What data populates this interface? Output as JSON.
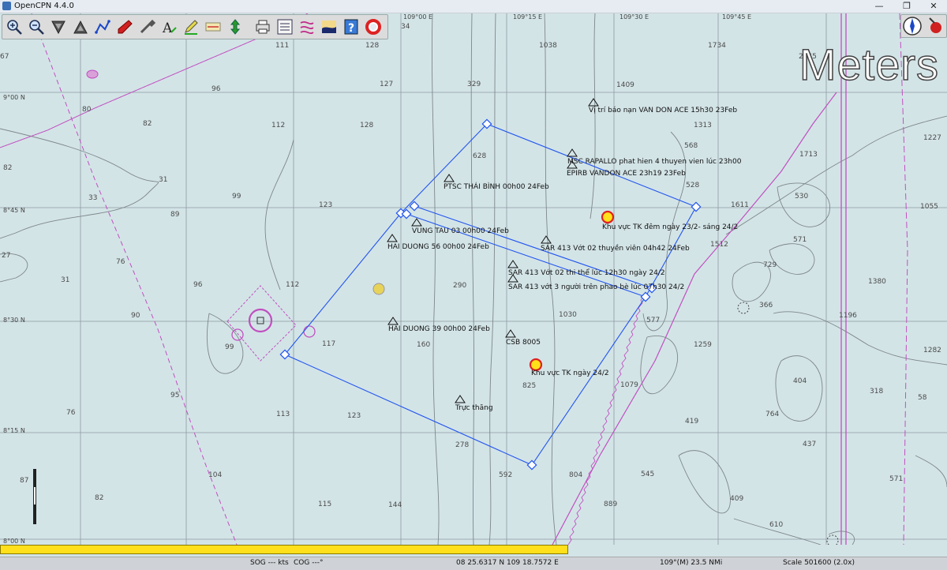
{
  "window": {
    "title": "OpenCPN 4.4.0",
    "minimize_symbol": "—",
    "restore_symbol": "❐",
    "close_symbol": "✕"
  },
  "toolbar": {
    "tools": [
      {
        "id": "zoom-in",
        "icon": "zoom-in-icon"
      },
      {
        "id": "zoom-out",
        "icon": "zoom-out-icon"
      },
      {
        "id": "scale-in",
        "icon": "scale-in-icon"
      },
      {
        "id": "scale-out",
        "icon": "scale-out-icon"
      },
      {
        "id": "route",
        "icon": "route-icon"
      },
      {
        "id": "auto-follow",
        "icon": "ship-icon"
      },
      {
        "id": "settings",
        "icon": "wrench-icon"
      },
      {
        "id": "text",
        "icon": "text-icon"
      },
      {
        "id": "current",
        "icon": "pencil-icon"
      },
      {
        "id": "tides",
        "icon": "tide-icon"
      },
      {
        "id": "drop-mark",
        "icon": "mark-icon"
      },
      {
        "id": "print",
        "icon": "print-icon"
      },
      {
        "id": "route-manager",
        "icon": "route-manager-icon"
      },
      {
        "id": "track",
        "icon": "track-icon"
      },
      {
        "id": "color-scheme",
        "icon": "color-scheme-icon"
      },
      {
        "id": "help",
        "icon": "help-icon"
      },
      {
        "id": "mob",
        "icon": "lifebuoy-icon"
      }
    ]
  },
  "overlay": {
    "units": "Meters"
  },
  "grid": {
    "lat_labels": [
      "9°00 N",
      "8°45 N",
      "8°30 N",
      "8°15 N",
      "8°00 N"
    ],
    "lon_labels": [
      "109°00 E",
      "109°15 E",
      "109°30 E",
      "109°45 E"
    ]
  },
  "depths": [
    {
      "v": "111"
    },
    {
      "v": "128"
    },
    {
      "v": "34"
    },
    {
      "v": "1038"
    },
    {
      "v": "1734"
    },
    {
      "v": "2045"
    },
    {
      "v": "67"
    },
    {
      "v": "96"
    },
    {
      "v": "127"
    },
    {
      "v": "329"
    },
    {
      "v": "1409"
    },
    {
      "v": "80"
    },
    {
      "v": "82"
    },
    {
      "v": "112"
    },
    {
      "v": "128"
    },
    {
      "v": "1313"
    },
    {
      "v": "568"
    },
    {
      "v": "1227"
    },
    {
      "v": "82"
    },
    {
      "v": "31"
    },
    {
      "v": "628"
    },
    {
      "v": "1713"
    },
    {
      "v": "33"
    },
    {
      "v": "99"
    },
    {
      "v": "528"
    },
    {
      "v": "530"
    },
    {
      "v": "89"
    },
    {
      "v": "123"
    },
    {
      "v": "1611"
    },
    {
      "v": "1055"
    },
    {
      "v": "571"
    },
    {
      "v": "1512"
    },
    {
      "v": "27"
    },
    {
      "v": "76"
    },
    {
      "v": "729"
    },
    {
      "v": "31"
    },
    {
      "v": "96"
    },
    {
      "v": "112"
    },
    {
      "v": "290"
    },
    {
      "v": "1380"
    },
    {
      "v": "366"
    },
    {
      "v": "90"
    },
    {
      "v": "1030"
    },
    {
      "v": "577"
    },
    {
      "v": "1196"
    },
    {
      "v": "117"
    },
    {
      "v": "160"
    },
    {
      "v": "1259"
    },
    {
      "v": "1282"
    },
    {
      "v": "99"
    },
    {
      "v": "1079"
    },
    {
      "v": "404"
    },
    {
      "v": "825"
    },
    {
      "v": "318"
    },
    {
      "v": "95"
    },
    {
      "v": "58"
    },
    {
      "v": "76"
    },
    {
      "v": "113"
    },
    {
      "v": "123"
    },
    {
      "v": "764"
    },
    {
      "v": "419"
    },
    {
      "v": "278"
    },
    {
      "v": "437"
    },
    {
      "v": "87"
    },
    {
      "v": "104"
    },
    {
      "v": "592"
    },
    {
      "v": "804"
    },
    {
      "v": "545"
    },
    {
      "v": "571"
    },
    {
      "v": "82"
    },
    {
      "v": "115"
    },
    {
      "v": "144"
    },
    {
      "v": "889"
    },
    {
      "v": "409"
    },
    {
      "v": "610"
    }
  ],
  "marks": [
    {
      "text": "Vị trí báo nạn VAN DON ACE 15h30 23Feb"
    },
    {
      "text": "MSC RAPALLO phat hien 4 thuyen vien lúc 23h00"
    },
    {
      "text": "EPIRB VANDON ACE 23h19 23Feb"
    },
    {
      "text": "PTSC THÁI BÌNH 00h00 24Feb"
    },
    {
      "text": "VUNG TAU 03 00h00 24Feb"
    },
    {
      "text": "HAI DUONG 56 00h00 24Feb"
    },
    {
      "text": "SAR 413 Vớt 02 thuyền viên 04h42 24Feb"
    },
    {
      "text": "SAR 413 Vớt 02 thi thể lúc 12h30 ngày 24/2"
    },
    {
      "text": "SAR 413 vớt 3 người trên phao bè lúc 07h30 24/2"
    },
    {
      "text": "HAI DUONG 39 00h00 24Feb"
    },
    {
      "text": "CSB 8005"
    },
    {
      "text": "Trực thăng"
    },
    {
      "text": "Khu vực TK đêm ngày 23/2- sáng 24/2"
    },
    {
      "text": "Khu vực TK ngày 24/2"
    }
  ],
  "progress": {
    "fraction": 0.6
  },
  "status": {
    "sog": "SOG --- kts",
    "cog": "COG ---°",
    "position": "08 25.6317 N   109 18.7572 E",
    "bearing": "109°(M)  23.5 NMi",
    "scale": "Scale 501600 (2.0x)"
  },
  "colors": {
    "sea": "#d3e4e7",
    "grid": "#8d9aa0",
    "route": "#2255ee",
    "boundary_magenta": "#c050c0",
    "contour": "#7d878b",
    "highlight_yellow": "#ffe01a"
  }
}
